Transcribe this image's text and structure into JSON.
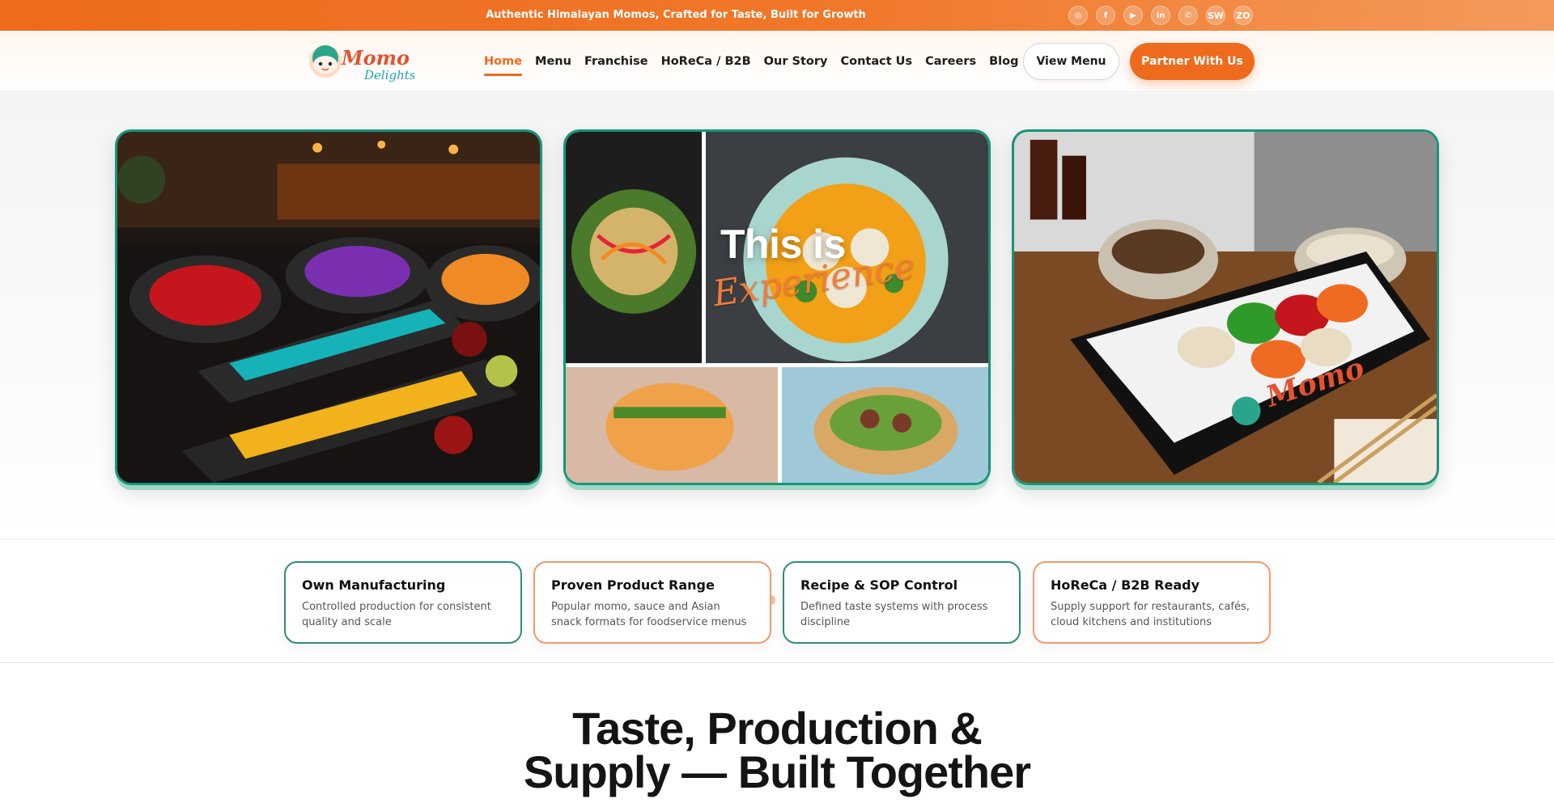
{
  "topbar": {
    "message": "Authentic Himalayan Momos, Crafted for Taste, Built for Growth",
    "socials": [
      {
        "icon": "instagram-icon",
        "label": "◎"
      },
      {
        "icon": "facebook-icon",
        "label": "f"
      },
      {
        "icon": "youtube-icon",
        "label": "▶"
      },
      {
        "icon": "linkedin-icon",
        "label": "in"
      },
      {
        "icon": "whatsapp-icon",
        "label": "✆"
      },
      {
        "icon": "swiggy-icon",
        "label": "SW"
      },
      {
        "icon": "zomato-icon",
        "label": "ZO"
      }
    ]
  },
  "header": {
    "logo_text": "Momo Delights",
    "nav": [
      "Home",
      "Menu",
      "Franchise",
      "HoReCa / B2B",
      "Our Story",
      "Contact Us",
      "Careers",
      "Blog"
    ],
    "active_nav": "Home",
    "view_menu_label": "View Menu",
    "partner_label": "Partner With Us"
  },
  "hero": {
    "slide_title": "This is",
    "slide_script": "Experience",
    "slide_count": 8,
    "active_slide": 1
  },
  "features": [
    {
      "title": "Own Manufacturing",
      "desc": "Controlled production for consistent quality and scale"
    },
    {
      "title": "Proven Product Range",
      "desc": "Popular momo, sauce and Asian snack formats for foodservice menus"
    },
    {
      "title": "Recipe & SOP Control",
      "desc": "Defined taste systems with process discipline"
    },
    {
      "title": "HoReCa / B2B Ready",
      "desc": "Supply support for restaurants, cafés, cloud kitchens and institutions"
    }
  ],
  "section": {
    "title_line1": "Taste, Production &",
    "title_line2": "Supply — Built Together"
  },
  "colors": {
    "brand_orange": "#ee6a1c",
    "brand_teal": "#16957a"
  }
}
